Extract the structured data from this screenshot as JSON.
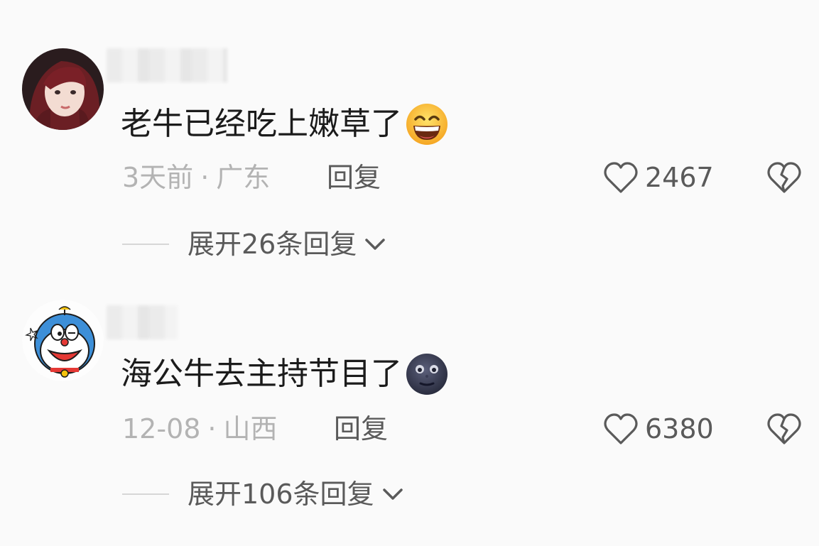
{
  "comments": [
    {
      "text": "老牛已经吃上嫩草了",
      "emoji_icon": "grinning-face-icon",
      "date": "3天前",
      "separator": "·",
      "location": "广东",
      "reply_label": "回复",
      "likes": "2467",
      "expand_label": "展开26条回复"
    },
    {
      "text": "海公牛去主持节目了",
      "emoji_icon": "new-moon-face-icon",
      "date": "12-08",
      "separator": "·",
      "location": "山西",
      "reply_label": "回复",
      "likes": "6380",
      "expand_label": "展开106条回复"
    }
  ],
  "colors": {
    "background": "#fafafa",
    "text_primary": "#1b1b1b",
    "text_meta": "#b3b3b3",
    "text_action": "#5a5a5a"
  }
}
